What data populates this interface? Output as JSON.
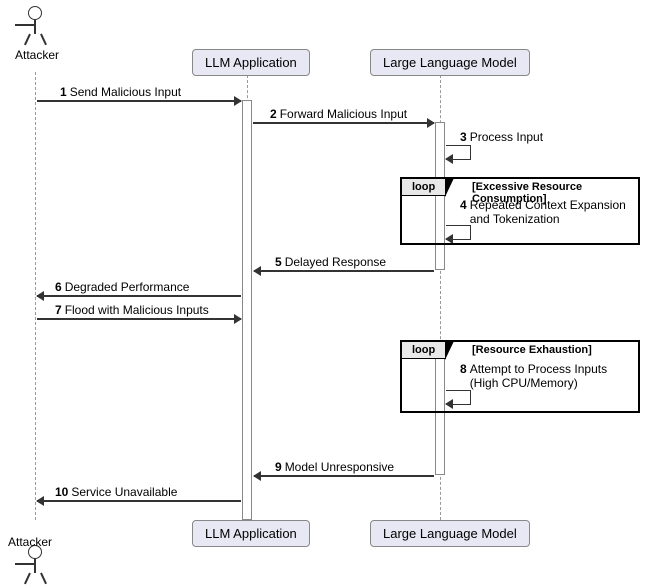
{
  "participants": {
    "attacker": "Attacker",
    "llm_app": "LLM Application",
    "llm": "Large Language Model"
  },
  "messages": {
    "m1": {
      "num": "1",
      "text": "Send Malicious Input"
    },
    "m2": {
      "num": "2",
      "text": "Forward Malicious Input"
    },
    "m3": {
      "num": "3",
      "text": "Process Input"
    },
    "m4": {
      "num": "4",
      "text": "Repeated Context Expansion\nand Tokenization"
    },
    "m5": {
      "num": "5",
      "text": "Delayed Response"
    },
    "m6": {
      "num": "6",
      "text": "Degraded Performance"
    },
    "m7": {
      "num": "7",
      "text": "Flood with Malicious Inputs"
    },
    "m8": {
      "num": "8",
      "text": "Attempt to Process Inputs\n(High CPU/Memory)"
    },
    "m9": {
      "num": "9",
      "text": "Model Unresponsive"
    },
    "m10": {
      "num": "10",
      "text": "Service Unavailable"
    }
  },
  "loops": {
    "loop1": {
      "tag": "loop",
      "cond": "[Excessive Resource Consumption]"
    },
    "loop2": {
      "tag": "loop",
      "cond": "[Resource Exhaustion]"
    }
  }
}
